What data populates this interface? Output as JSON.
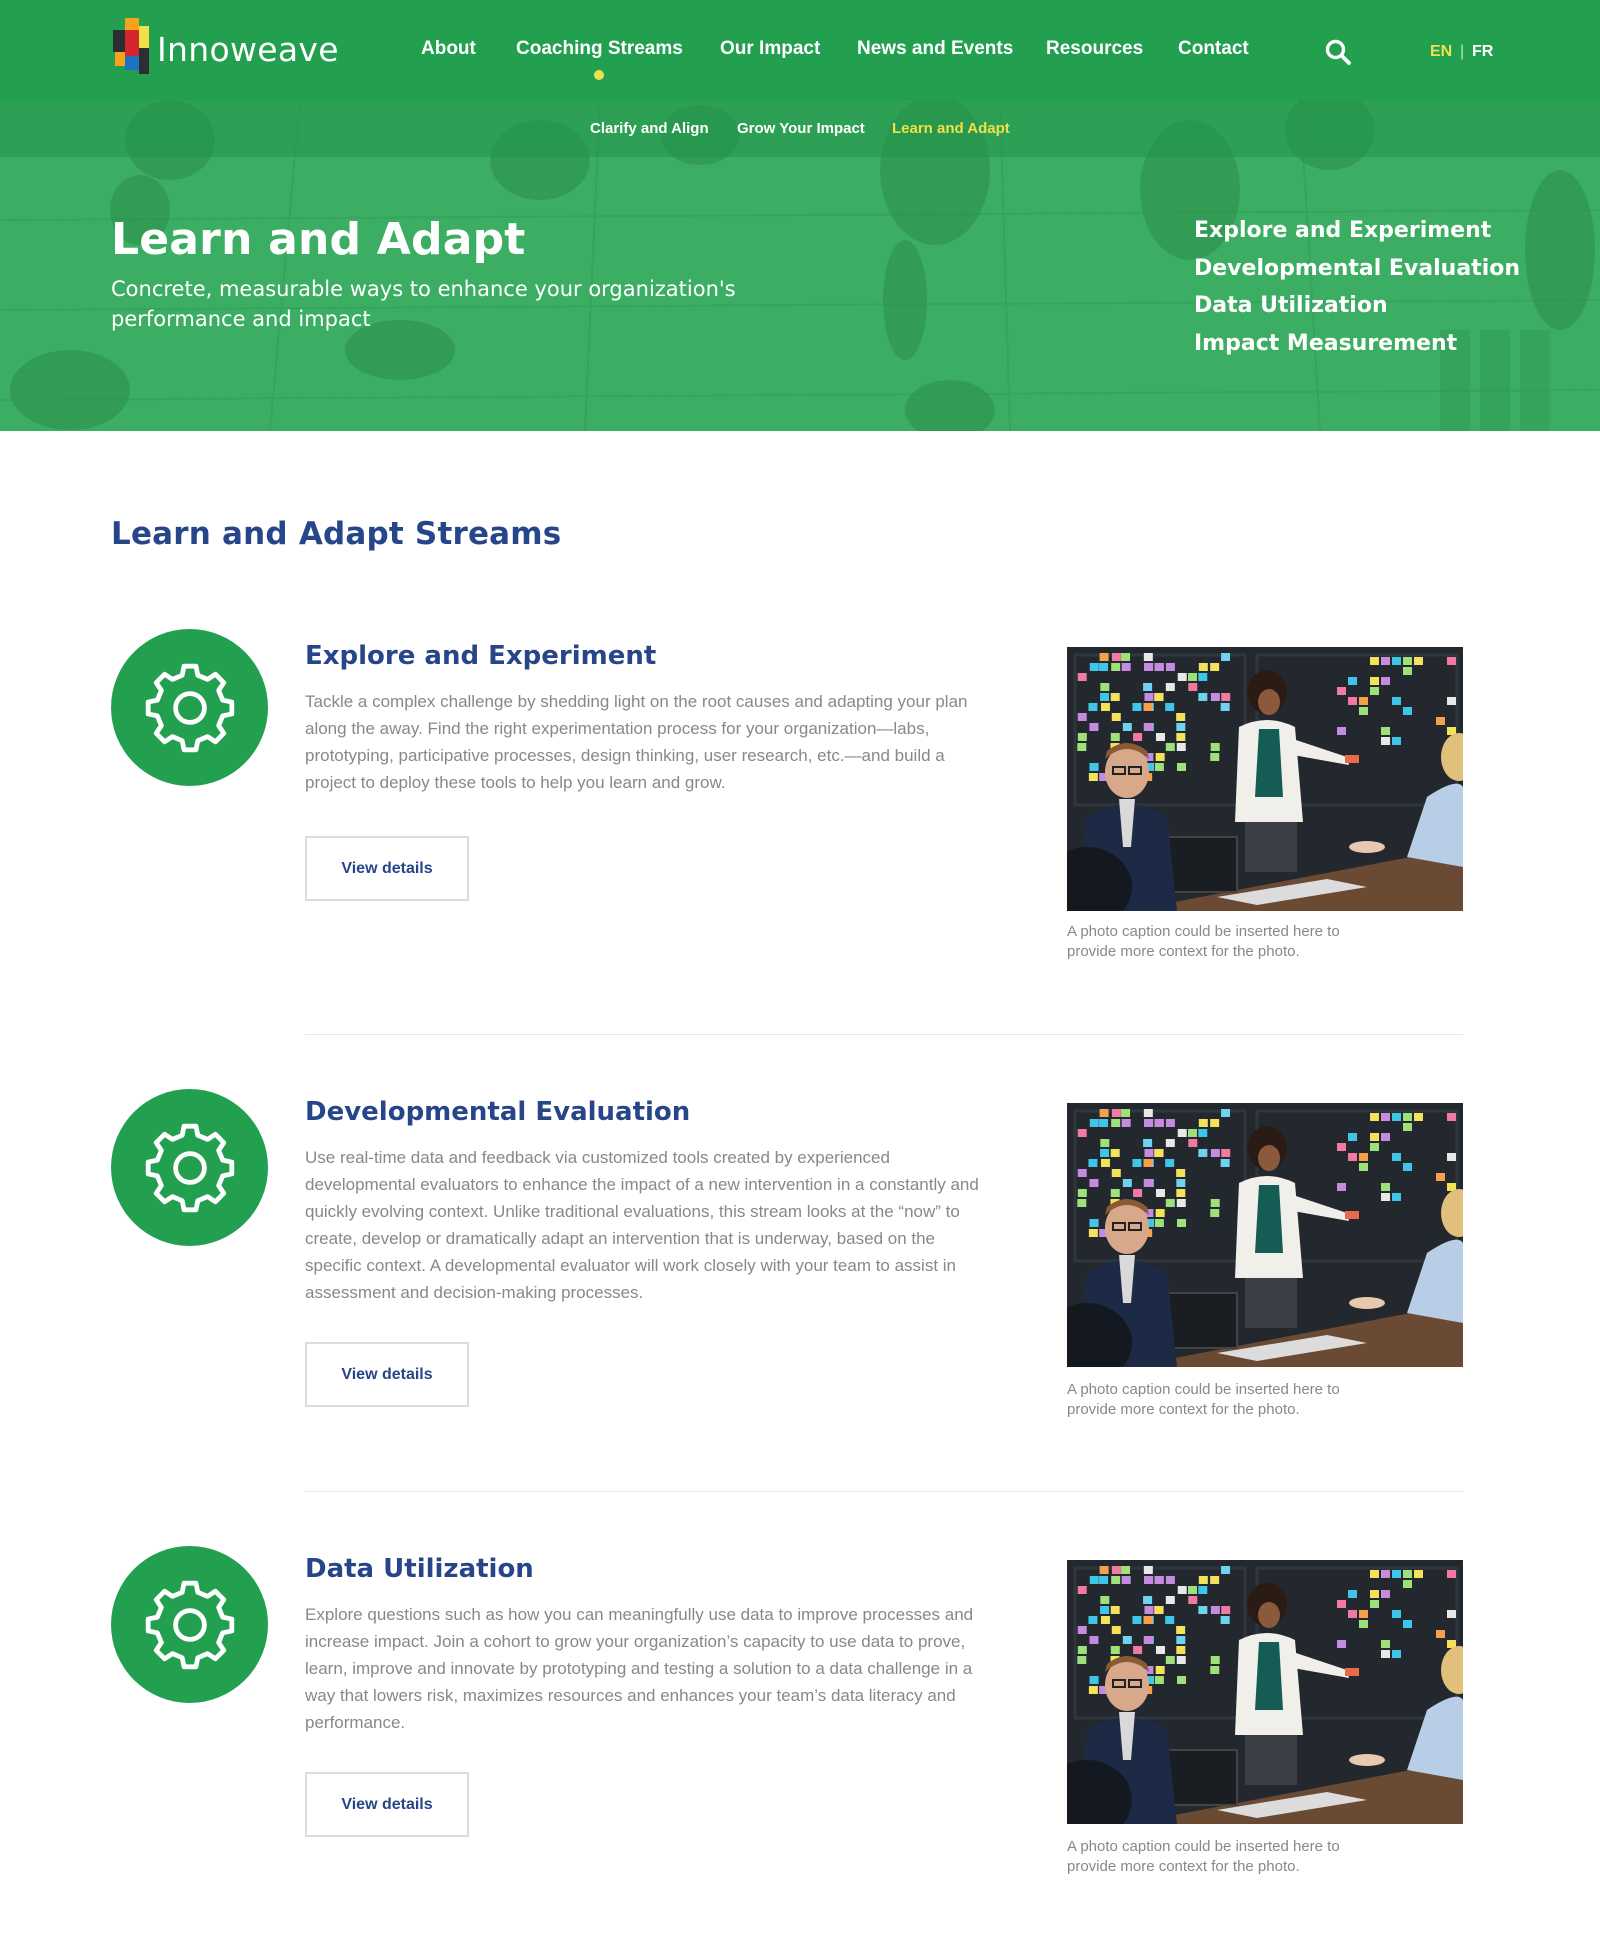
{
  "brand": {
    "name": "Innoweave"
  },
  "nav": {
    "items": [
      {
        "label": "About"
      },
      {
        "label": "Coaching Streams"
      },
      {
        "label": "Our Impact"
      },
      {
        "label": "News and Events"
      },
      {
        "label": "Resources"
      },
      {
        "label": "Contact"
      }
    ],
    "active_index": 1,
    "languages": [
      {
        "label": "EN",
        "active": true
      },
      {
        "label": "FR",
        "active": false
      }
    ],
    "lang_separator": "|"
  },
  "subnav": {
    "items": [
      {
        "label": "Clarify and Align"
      },
      {
        "label": "Grow Your Impact"
      },
      {
        "label": "Learn and Adapt"
      }
    ],
    "active_index": 2
  },
  "hero": {
    "title": "Learn and Adapt",
    "subtitle": "Concrete, measurable ways to enhance your organization's performance and impact",
    "links": [
      {
        "label": "Explore and Experiment"
      },
      {
        "label": "Developmental Evaluation"
      },
      {
        "label": "Data Utilization"
      },
      {
        "label": "Impact Measurement"
      }
    ]
  },
  "section": {
    "title": "Learn and Adapt Streams"
  },
  "streams": [
    {
      "title": "Explore and Experiment",
      "description": "Tackle a complex challenge by shedding light on the root causes and adapting your plan along the away. Find the right experimentation process for your organization—labs, prototyping, participative processes, design thinking, user research, etc.—and build a project to deploy these tools to help you learn and grow.",
      "button": "View details",
      "caption": "A photo caption could be inserted here to provide more context for the photo.",
      "icon": "gear-icon"
    },
    {
      "title": "Developmental Evaluation",
      "description": "Use real-time data and feedback via customized tools created by experienced developmental evaluators to enhance the impact of a new intervention in a constantly and quickly evolving context. Unlike traditional evaluations, this stream looks at the “now” to create, develop or dramatically adapt an intervention that is underway, based on the specific context. A developmental evaluator will work closely with your team to assist in assessment and decision-making processes.",
      "button": "View details",
      "caption": "A photo caption could be inserted here to provide more context for the photo.",
      "icon": "gear-icon"
    },
    {
      "title": "Data Utilization",
      "description": "Explore questions such as how you can meaningfully use data to improve processes and increase impact. Join a cohort to grow your organization’s capacity to use data to prove, learn, improve and innovate by prototyping and testing a solution to a data challenge in a way that lowers risk, maximizes resources and enhances your team’s data literacy and performance.",
      "button": "View details",
      "caption": "A photo caption could be inserted here to provide more context for the photo.",
      "icon": "gear-icon"
    }
  ],
  "colors": {
    "primary_green": "#22a050",
    "hero_green": "#3aad62",
    "navy": "#27468a",
    "accent_yellow": "#f0e04a",
    "muted_text": "#888888"
  }
}
